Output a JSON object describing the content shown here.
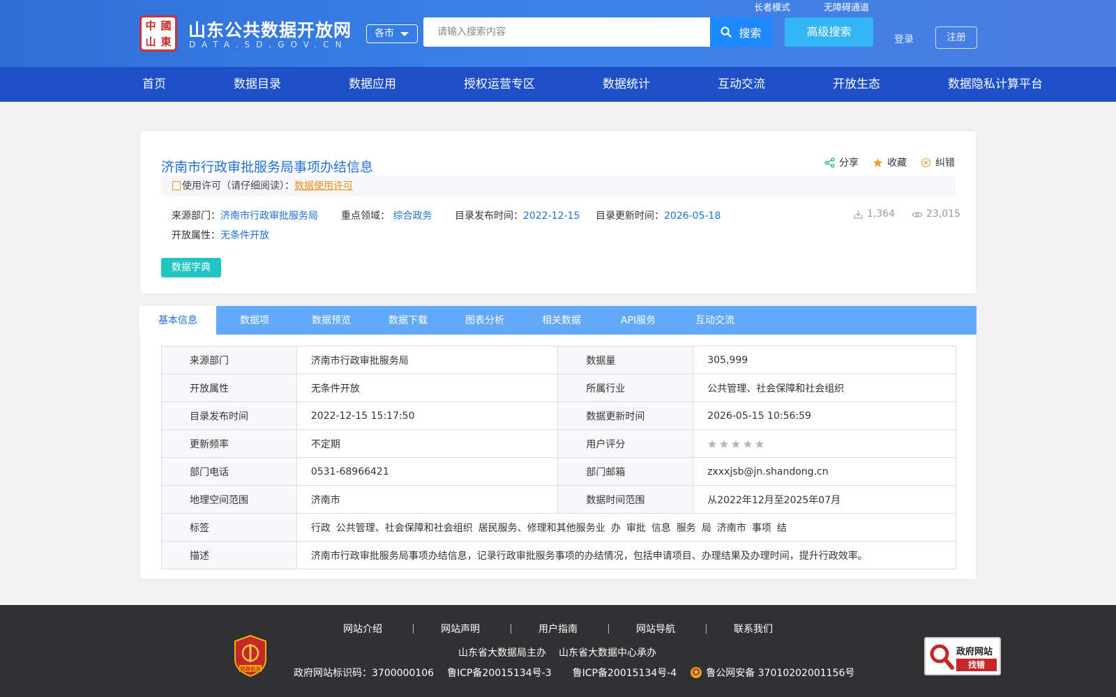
{
  "header": {
    "logo_chars": [
      "中",
      "國",
      "山",
      "東"
    ],
    "site_title": "山东公共数据开放网",
    "site_domain": "DATA.SD.GOV.CN",
    "city_select": "各市",
    "search_placeholder": "请输入搜索内容",
    "search_label": "搜索",
    "advanced_search": "高级搜索",
    "elder_mode": "长者模式",
    "barrier_free": "无障碍通道",
    "login": "登录",
    "register": "注册"
  },
  "nav": [
    "首页",
    "数据目录",
    "数据应用",
    "授权运营专区",
    "数据统计",
    "互动交流",
    "开放生态",
    "数据隐私计算平台"
  ],
  "dataset": {
    "title": "济南市行政审批服务局事项办结信息",
    "actions": {
      "share": "分享",
      "favorite": "收藏",
      "correct": "纠错"
    },
    "license_prefix": "使用许可（请仔细阅读）：",
    "license_link": "数据使用许可",
    "source_label": "来源部门：",
    "source_value": "济南市行政审批服务局",
    "domain_label": "重点领域：",
    "domain_value": "综合政务",
    "publish_label": "目录发布时间：",
    "publish_value": "2022-12-15",
    "update_label": "目录更新时间：",
    "update_value": "2026-05-18",
    "open_label": "开放属性：",
    "open_value": "无条件开放",
    "downloads": "1,364",
    "views": "23,015",
    "dict_button": "数据字典"
  },
  "tabs": [
    "基本信息",
    "数据项",
    "数据预览",
    "数据下载",
    "图表分析",
    "相关数据",
    "API服务",
    "互动交流"
  ],
  "info_table": {
    "rows": [
      [
        "来源部门",
        "济南市行政审批服务局",
        "数据量",
        "305,999"
      ],
      [
        "开放属性",
        "无条件开放",
        "所属行业",
        "公共管理、社会保障和社会组织"
      ],
      [
        "目录发布时间",
        "2022-12-15 15:17:50",
        "数据更新时间",
        "2026-05-15 10:56:59"
      ],
      [
        "更新频率",
        "不定期",
        "用户评分",
        ""
      ],
      [
        "部门电话",
        "0531-68966421",
        "部门邮箱",
        "zxxxjsb@jn.shandong.cn"
      ],
      [
        "地理空间范围",
        "济南市",
        "数据时间范围",
        "从2022年12月至2025年07月"
      ]
    ],
    "tags_label": "标签",
    "tags": [
      "行政",
      "公共管理、社会保障和社会组织",
      "居民服务、修理和其他服务业",
      "办",
      "审批",
      "信息",
      "服务",
      "局",
      "济南市",
      "事项",
      "结"
    ],
    "desc_label": "描述",
    "desc": "济南市行政审批服务局事项办结信息，记录行政审批服务事项的办结情况，包括申请项目、办理结果及办理时间，提升行政效率。",
    "rating": 0,
    "rating_max": 5
  },
  "footer": {
    "links": [
      "网站介绍",
      "网站声明",
      "用户指南",
      "网站导航",
      "联系我们"
    ],
    "host": "山东省大数据局主办",
    "undertake": "山东省大数据中心承办",
    "site_code": "政府网站标识码：3700000106",
    "icp3": "鲁ICP备20015134号-3",
    "icp4": "鲁ICP备20015134号-4",
    "police": "鲁公网安备 37010202001156号",
    "party_badge": "党政机关",
    "gov_check_1": "政府网站",
    "gov_check_2": "找错"
  },
  "colors": {
    "header_bg": "#3a82ea",
    "nav_bg": "#1d4fc6",
    "link_blue": "#1e6fd9",
    "accent_orange": "#f08c1e",
    "teal_button": "#22c4c4",
    "tab_bar": "#63a9f9"
  }
}
